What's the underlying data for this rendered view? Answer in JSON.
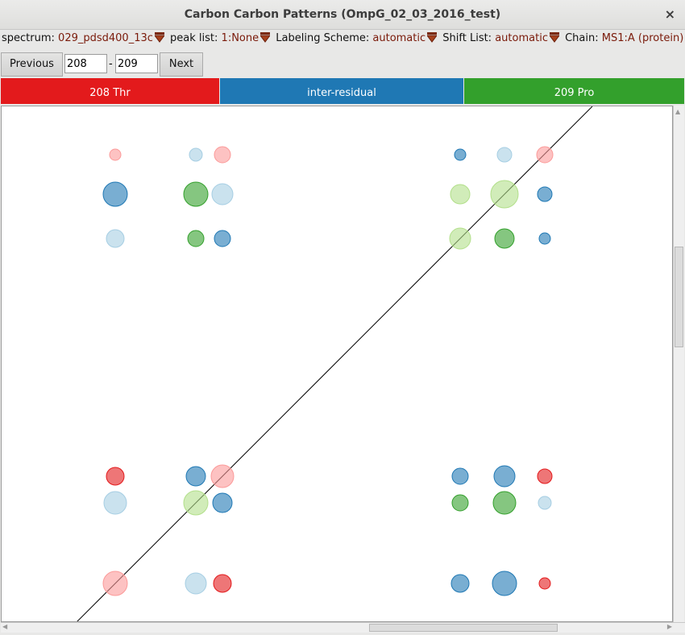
{
  "window": {
    "title": "Carbon Carbon Patterns (OmpG_02_03_2016_test)",
    "close_glyph": "×"
  },
  "options": {
    "spectrum_label": "spectrum:",
    "spectrum_value": "029_pdsd400_13c",
    "peaklist_label": "peak list:",
    "peaklist_value": "1:None",
    "labeling_label": "Labeling Scheme:",
    "labeling_value": "automatic",
    "shift_label": "Shift List:",
    "shift_value": "automatic",
    "chain_label": "Chain:",
    "chain_value": "MS1:A (protein)"
  },
  "nav": {
    "previous_label": "Previous",
    "from_value": "208",
    "dash": "-",
    "to_value": "209",
    "next_label": "Next"
  },
  "headers": [
    {
      "label": "208 Thr",
      "color": "#e31a1c"
    },
    {
      "label": "inter-residual",
      "color": "#1f78b4"
    },
    {
      "label": "209 Pro",
      "color": "#33a02c"
    }
  ],
  "palette": {
    "red": "#e31a1c",
    "light_red": "#fb9a99",
    "blue": "#1f78b4",
    "light_blue": "#a6cee3",
    "green": "#33a02c",
    "light_green": "#b2df8a"
  },
  "icons": {
    "dropdown": "dropdown-arrow-icon",
    "close": "close-icon"
  }
}
